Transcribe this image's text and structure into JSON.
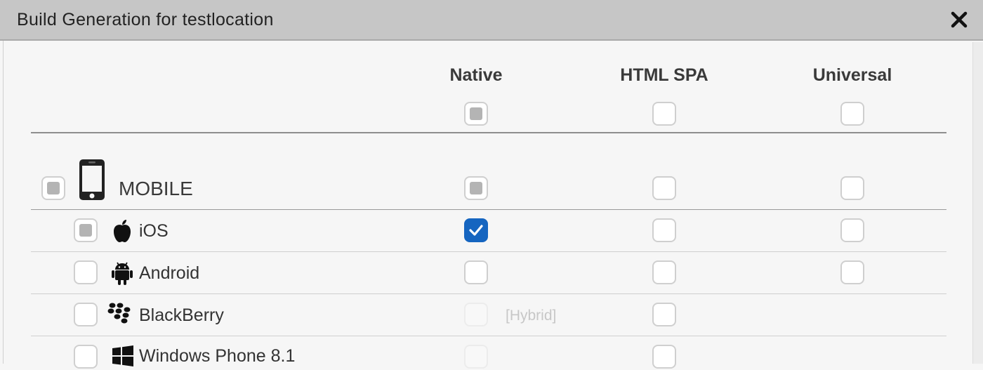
{
  "dialog": {
    "title": "Build Generation for testlocation"
  },
  "columns": [
    {
      "label": "Native",
      "header_state": "partial"
    },
    {
      "label": "HTML SPA",
      "header_state": "unchecked"
    },
    {
      "label": "Universal",
      "header_state": "unchecked"
    }
  ],
  "groups": [
    {
      "label": "MOBILE",
      "icon": "smartphone-icon",
      "select_state": "partial",
      "native": "partial",
      "html_spa": "unchecked",
      "universal": "unchecked"
    }
  ],
  "platforms": [
    {
      "label": "iOS",
      "icon": "apple-icon",
      "select_state": "partial",
      "native": "checked",
      "html_spa": "unchecked",
      "universal": "unchecked"
    },
    {
      "label": "Android",
      "icon": "android-icon",
      "select_state": "unchecked",
      "native": "unchecked",
      "html_spa": "unchecked",
      "universal": "unchecked"
    },
    {
      "label": "BlackBerry",
      "icon": "blackberry-icon",
      "select_state": "unchecked",
      "native": "disabled",
      "native_note": "[Hybrid]",
      "html_spa": "unchecked",
      "universal": null
    },
    {
      "label": "Windows Phone 8.1",
      "icon": "windows-icon",
      "select_state": "unchecked",
      "native": "disabled",
      "html_spa": "unchecked",
      "universal": null
    }
  ],
  "colors": {
    "accent": "#1565c0",
    "partial_fill": "#b4b4b4",
    "titlebar": "#c6c6c6"
  }
}
